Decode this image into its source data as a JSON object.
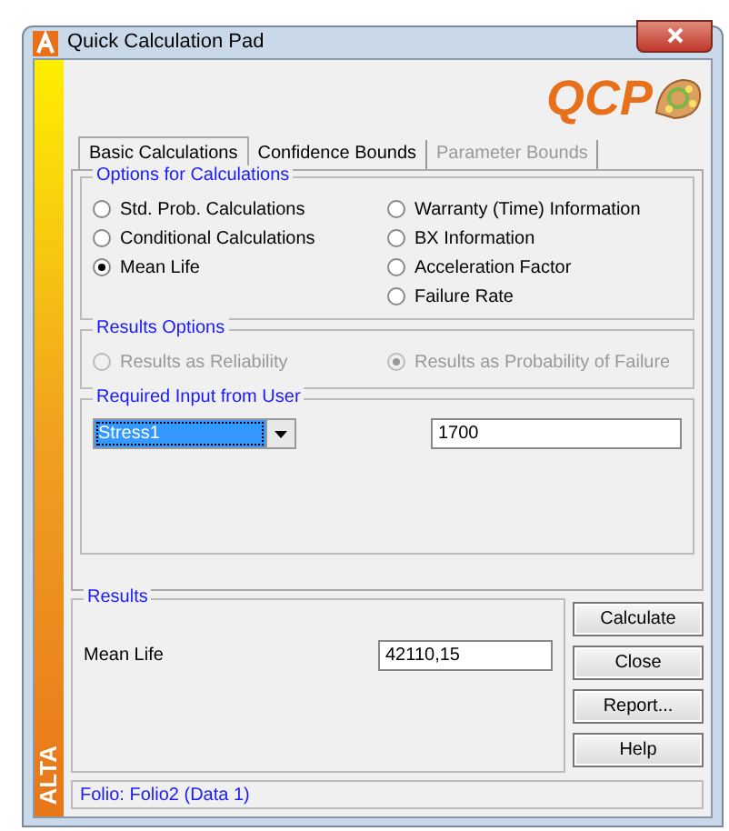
{
  "window": {
    "title": "Quick Calculation Pad",
    "logo": "QCP",
    "side_label": "ALTA"
  },
  "tabs": [
    {
      "label": "Basic Calculations",
      "selected": true,
      "disabled": false
    },
    {
      "label": "Confidence Bounds",
      "selected": false,
      "disabled": false
    },
    {
      "label": "Parameter Bounds",
      "selected": false,
      "disabled": true
    }
  ],
  "options_group": {
    "title": "Options for Calculations",
    "columns": [
      [
        {
          "label": "Std. Prob. Calculations",
          "selected": false
        },
        {
          "label": "Conditional Calculations",
          "selected": false
        },
        {
          "label": "Mean Life",
          "selected": true
        }
      ],
      [
        {
          "label": "Warranty (Time) Information",
          "selected": false
        },
        {
          "label": "BX Information",
          "selected": false
        },
        {
          "label": "Acceleration Factor",
          "selected": false
        },
        {
          "label": "Failure Rate",
          "selected": false
        }
      ]
    ]
  },
  "results_options": {
    "title": "Results Options",
    "disabled": true,
    "options": [
      {
        "label": "Results as Reliability",
        "selected": false
      },
      {
        "label": "Results as Probability of Failure",
        "selected": true
      }
    ]
  },
  "required_input": {
    "title": "Required Input from User",
    "dropdown": "Stress1",
    "value": "1700"
  },
  "results": {
    "title": "Results",
    "label": "Mean Life",
    "value": "42110,15"
  },
  "buttons": [
    "Calculate",
    "Close",
    "Report...",
    "Help"
  ],
  "status_bar": "Folio: Folio2 (Data 1)"
}
